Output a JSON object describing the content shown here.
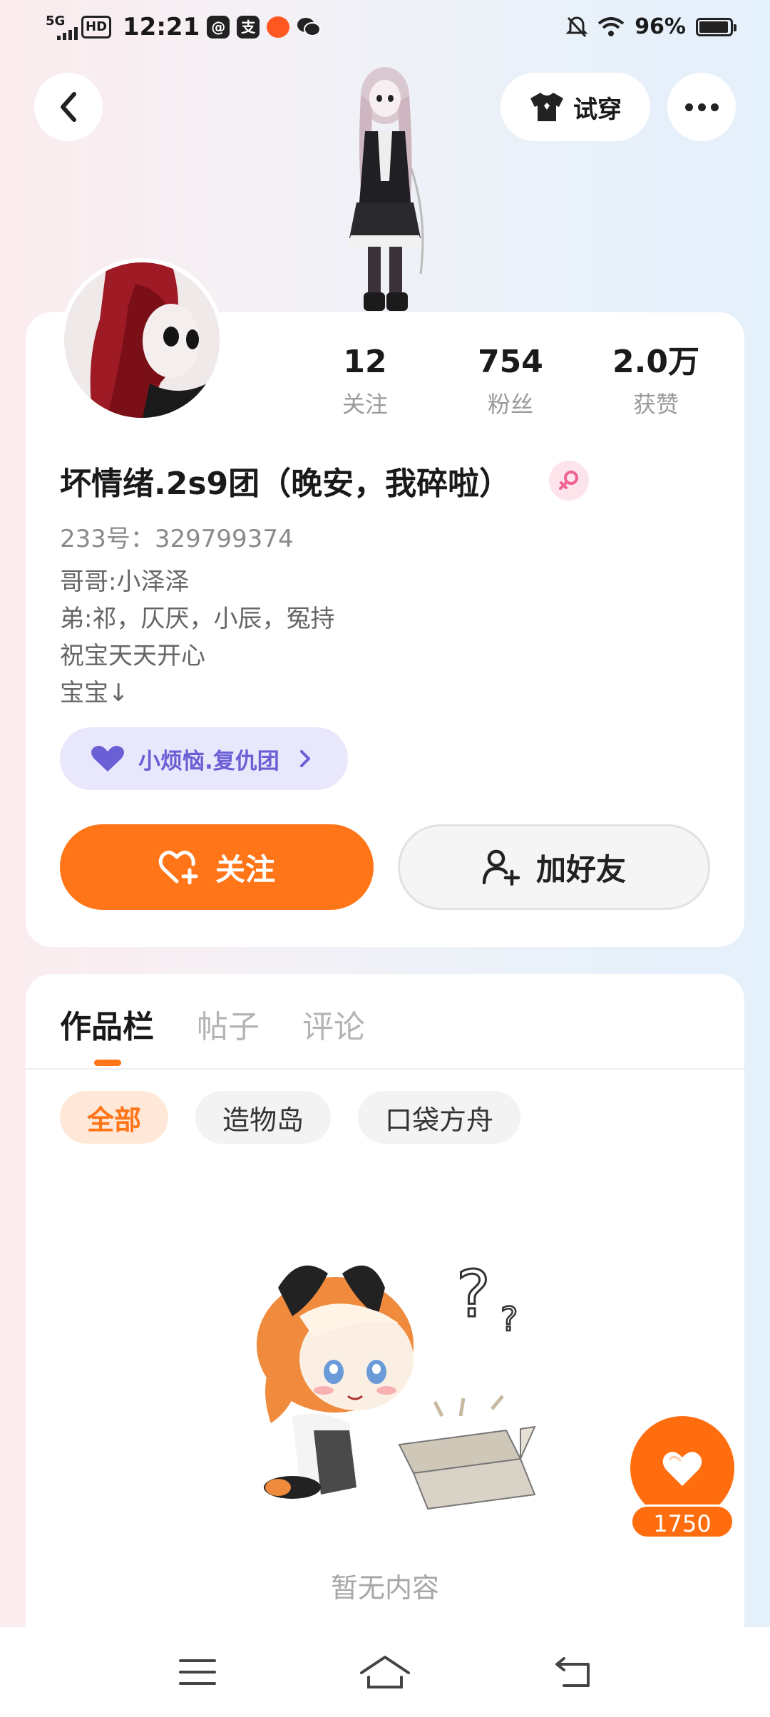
{
  "status_bar": {
    "network": "5G",
    "hd": "HD",
    "time": "12:21",
    "battery": "96%",
    "battery_level": 0.96,
    "icons": [
      "qq-icon",
      "alipay-icon",
      "app-icon",
      "wechat-icon",
      "mute-icon",
      "wifi-icon"
    ]
  },
  "header": {
    "tryon_label": "试穿"
  },
  "profile": {
    "stats": [
      {
        "value": "12",
        "label": "关注"
      },
      {
        "value": "754",
        "label": "粉丝"
      },
      {
        "value": "2.0万",
        "label": "获赞"
      }
    ],
    "nickname": "坏情绪.2s9团（晚安，我碎啦）",
    "gender": "female",
    "uid": "233号：329799374",
    "bio": [
      "哥哥:小泽泽",
      "弟:祁，仄厌，小辰，冤持",
      "祝宝天天开心",
      "宝宝↓"
    ],
    "group_label": "小烦恼.复仇团",
    "follow_label": "关注",
    "add_friend_label": "加好友"
  },
  "works": {
    "tabs": [
      "作品栏",
      "帖子",
      "评论"
    ],
    "active_tab": 0,
    "chips": [
      "全部",
      "造物岛",
      "口袋方舟"
    ],
    "active_chip": 0,
    "empty_text": "暂无内容"
  },
  "like": {
    "count": "1750"
  },
  "colors": {
    "accent": "#ff7518",
    "group_text": "#6b5fd6",
    "group_bg": "#e9e7fb"
  }
}
